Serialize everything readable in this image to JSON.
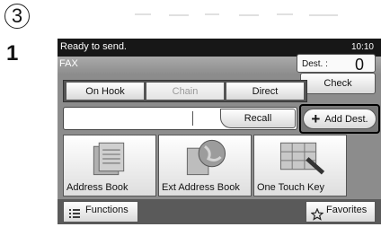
{
  "step": {
    "circle": "3",
    "number": "1"
  },
  "status": {
    "message": "Ready to send.",
    "time": "10:10"
  },
  "title": {
    "fax": "FAX",
    "dest_label": "Dest. :",
    "dest_count": "0"
  },
  "buttons": {
    "check": "Check",
    "on_hook": "On Hook",
    "chain": "Chain",
    "direct": "Direct",
    "recall": "Recall",
    "add_dest": "Add Dest.",
    "address_book": "Address Book",
    "ext_address_book": "Ext Address Book",
    "one_touch_key": "One Touch Key",
    "functions": "Functions",
    "favorites": "Favorites"
  },
  "input": {
    "value": ""
  },
  "icons": [
    "address-book-icon",
    "globe-book-icon",
    "one-touch-key-icon",
    "list-icon",
    "star-icon",
    "plus-icon"
  ]
}
